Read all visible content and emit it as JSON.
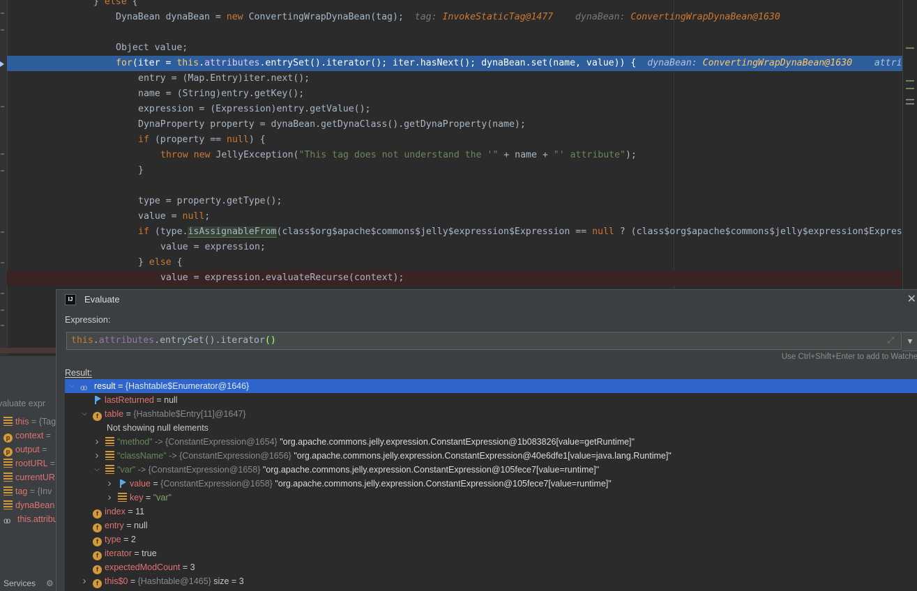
{
  "editor": {
    "lines": [
      [
        {
          "t": "} ",
          "c": ""
        },
        {
          "t": "else",
          "c": "kw"
        },
        {
          "t": " {",
          "c": ""
        }
      ],
      [
        {
          "t": "DynaBean dynaBean = ",
          "c": ""
        },
        {
          "t": "new",
          "c": "kw"
        },
        {
          "t": " ConvertingWrapDynaBean(tag);",
          "c": ""
        },
        {
          "t": "  tag: ",
          "c": "hint"
        },
        {
          "t": "InvokeStaticTag@1477",
          "c": "hv"
        },
        {
          "t": "    dynaBean: ",
          "c": "hint"
        },
        {
          "t": "ConvertingWrapDynaBean@1630",
          "c": "hv"
        }
      ],
      [],
      [
        {
          "t": "Object value;",
          "c": ""
        }
      ],
      [
        {
          "t": "for",
          "c": "kw"
        },
        {
          "t": "(iter = ",
          "c": ""
        },
        {
          "t": "this",
          "c": "kw"
        },
        {
          "t": ".",
          "c": ""
        },
        {
          "t": "attributes",
          "c": "fld"
        },
        {
          "t": ".entrySet().iterator(); iter.hasNext(); dynaBean.set(name, value)) {",
          "c": ""
        },
        {
          "t": "  dynaBean: ",
          "c": "hint"
        },
        {
          "t": "ConvertingWrapDynaBean@1630",
          "c": "hv"
        },
        {
          "t": "    attri",
          "c": "hint"
        }
      ],
      [
        {
          "t": "entry = (Map.Entry)iter.next();",
          "c": ""
        }
      ],
      [
        {
          "t": "name = (String)entry.getKey();",
          "c": ""
        }
      ],
      [
        {
          "t": "expression = (Expression)entry.getValue();",
          "c": ""
        }
      ],
      [
        {
          "t": "DynaProperty property = dynaBean.getDynaClass().getDynaProperty(name);",
          "c": ""
        }
      ],
      [
        {
          "t": "if",
          "c": "kw"
        },
        {
          "t": " (property == ",
          "c": ""
        },
        {
          "t": "null",
          "c": "kw"
        },
        {
          "t": ") {",
          "c": ""
        }
      ],
      [
        {
          "t": "throw new",
          "c": "kw"
        },
        {
          "t": " JellyException(",
          "c": ""
        },
        {
          "t": "\"This tag does not understand the '\"",
          "c": "str"
        },
        {
          "t": " + name + ",
          "c": ""
        },
        {
          "t": "\"' attribute\"",
          "c": "str"
        },
        {
          "t": ");",
          "c": ""
        }
      ],
      [
        {
          "t": "}",
          "c": ""
        }
      ],
      [],
      [
        {
          "t": "type = property.getType();",
          "c": ""
        }
      ],
      [
        {
          "t": "value = ",
          "c": ""
        },
        {
          "t": "null",
          "c": "kw"
        },
        {
          "t": ";",
          "c": ""
        }
      ],
      [
        {
          "t": "if",
          "c": "kw"
        },
        {
          "t": " (type.",
          "c": ""
        },
        {
          "t": "isAssignableFrom",
          "c": "hl"
        },
        {
          "t": "(class$org$apache$commons$jelly$expression$Expression == ",
          "c": ""
        },
        {
          "t": "null",
          "c": "kw"
        },
        {
          "t": " ? (class$org$apache$commons$jelly$expression$Express",
          "c": ""
        }
      ],
      [
        {
          "t": "value = expression;",
          "c": ""
        }
      ],
      [
        {
          "t": "} ",
          "c": ""
        },
        {
          "t": "else",
          "c": "kw"
        },
        {
          "t": " {",
          "c": ""
        }
      ],
      [
        {
          "t": "value = expression.evaluateRecurse(context);",
          "c": ""
        }
      ]
    ]
  },
  "variables": [
    {
      "icon": "list",
      "name": "this",
      "val": " = {Tag"
    },
    {
      "icon": "p",
      "name": "context",
      "val": " ="
    },
    {
      "icon": "p",
      "name": "output",
      "val": " ="
    },
    {
      "icon": "list",
      "name": "rootURL",
      "val": " ="
    },
    {
      "icon": "list",
      "name": "currentUR",
      "val": ""
    },
    {
      "icon": "list",
      "name": "tag",
      "val": " = {Inv"
    },
    {
      "icon": "list",
      "name": "dynaBean",
      "val": ""
    },
    {
      "icon": "oo",
      "name": "this.attribu",
      "val": ""
    }
  ],
  "variables_header": "valuate expr",
  "services_label": "Services",
  "dialog": {
    "title": "Evaluate",
    "expression_label": "Expression:",
    "expression_parts": [
      {
        "t": "this",
        "c": "kw"
      },
      {
        "t": ".",
        "c": ""
      },
      {
        "t": "attributes",
        "c": "fld"
      },
      {
        "t": ".entrySet().iterator",
        "c": ""
      },
      {
        "t": "()",
        "c": "paren"
      }
    ],
    "hint": "Use Ctrl+Shift+Enter to add to Watche",
    "result_label": "Result:",
    "tree": [
      {
        "indent": 0,
        "arrow": "v",
        "icon": "oo",
        "sel": true,
        "parts": [
          {
            "t": "result",
            "c": "tn"
          },
          {
            "t": " = ",
            "c": "eq"
          },
          {
            "t": "{Hashtable$Enumerator@1646}",
            "c": "tref"
          }
        ]
      },
      {
        "indent": 1,
        "arrow": "",
        "icon": "flag",
        "parts": [
          {
            "t": "lastReturned",
            "c": "tn"
          },
          {
            "t": " = null",
            "c": "eq"
          }
        ]
      },
      {
        "indent": 1,
        "arrow": "v",
        "icon": "f",
        "parts": [
          {
            "t": "table",
            "c": "tn"
          },
          {
            "t": " = ",
            "c": "eq"
          },
          {
            "t": "{Hashtable$Entry[11]@1647}",
            "c": "tref"
          }
        ]
      },
      {
        "indent": 2,
        "arrow": "",
        "icon": "",
        "parts": [
          {
            "t": "Not showing null elements",
            "c": "tnote"
          }
        ]
      },
      {
        "indent": 2,
        "arrow": ">",
        "icon": "list",
        "parts": [
          {
            "t": "\"method\"",
            "c": "tkey"
          },
          {
            "t": " -> ",
            "c": "tref"
          },
          {
            "t": "{ConstantExpression@1654}",
            "c": "tref"
          },
          {
            "t": " \"org.apache.commons.jelly.expression.ConstantExpression@1b083826[value=getRuntime]\"",
            "c": "tstr"
          }
        ]
      },
      {
        "indent": 2,
        "arrow": ">",
        "icon": "list",
        "parts": [
          {
            "t": "\"className\"",
            "c": "tkey"
          },
          {
            "t": " -> ",
            "c": "tref"
          },
          {
            "t": "{ConstantExpression@1656}",
            "c": "tref"
          },
          {
            "t": " \"org.apache.commons.jelly.expression.ConstantExpression@40e6dfe1[value=java.lang.Runtime]\"",
            "c": "tstr"
          }
        ]
      },
      {
        "indent": 2,
        "arrow": "v",
        "icon": "list",
        "parts": [
          {
            "t": "\"var\"",
            "c": "tkey"
          },
          {
            "t": " -> ",
            "c": "tref"
          },
          {
            "t": "{ConstantExpression@1658}",
            "c": "tref"
          },
          {
            "t": " \"org.apache.commons.jelly.expression.ConstantExpression@105fece7[value=runtime]\"",
            "c": "tstr"
          }
        ]
      },
      {
        "indent": 3,
        "arrow": ">",
        "icon": "flag",
        "parts": [
          {
            "t": "value",
            "c": "tn"
          },
          {
            "t": " = ",
            "c": "eq"
          },
          {
            "t": "{ConstantExpression@1658}",
            "c": "tref"
          },
          {
            "t": " \"org.apache.commons.jelly.expression.ConstantExpression@105fece7[value=runtime]\"",
            "c": "tstr"
          }
        ]
      },
      {
        "indent": 3,
        "arrow": ">",
        "icon": "list",
        "parts": [
          {
            "t": "key",
            "c": "tn"
          },
          {
            "t": " = ",
            "c": "eq"
          },
          {
            "t": "\"var\"",
            "c": "tgreen"
          }
        ]
      },
      {
        "indent": 1,
        "arrow": "",
        "icon": "f",
        "parts": [
          {
            "t": "index",
            "c": "tn"
          },
          {
            "t": " = 11",
            "c": "eq"
          }
        ]
      },
      {
        "indent": 1,
        "arrow": "",
        "icon": "f",
        "parts": [
          {
            "t": "entry",
            "c": "tn"
          },
          {
            "t": " = null",
            "c": "eq"
          }
        ]
      },
      {
        "indent": 1,
        "arrow": "",
        "icon": "f",
        "parts": [
          {
            "t": "type",
            "c": "tn"
          },
          {
            "t": " = 2",
            "c": "eq"
          }
        ]
      },
      {
        "indent": 1,
        "arrow": "",
        "icon": "f",
        "parts": [
          {
            "t": "iterator",
            "c": "tn"
          },
          {
            "t": " = true",
            "c": "eq"
          }
        ]
      },
      {
        "indent": 1,
        "arrow": "",
        "icon": "f",
        "parts": [
          {
            "t": "expectedModCount",
            "c": "tn"
          },
          {
            "t": " = 3",
            "c": "eq"
          }
        ]
      },
      {
        "indent": 1,
        "arrow": ">",
        "icon": "f",
        "parts": [
          {
            "t": "this$0",
            "c": "tn"
          },
          {
            "t": " = ",
            "c": "eq"
          },
          {
            "t": "{Hashtable@1465}",
            "c": "tref"
          },
          {
            "t": "  size = 3",
            "c": "eq"
          }
        ]
      }
    ]
  }
}
